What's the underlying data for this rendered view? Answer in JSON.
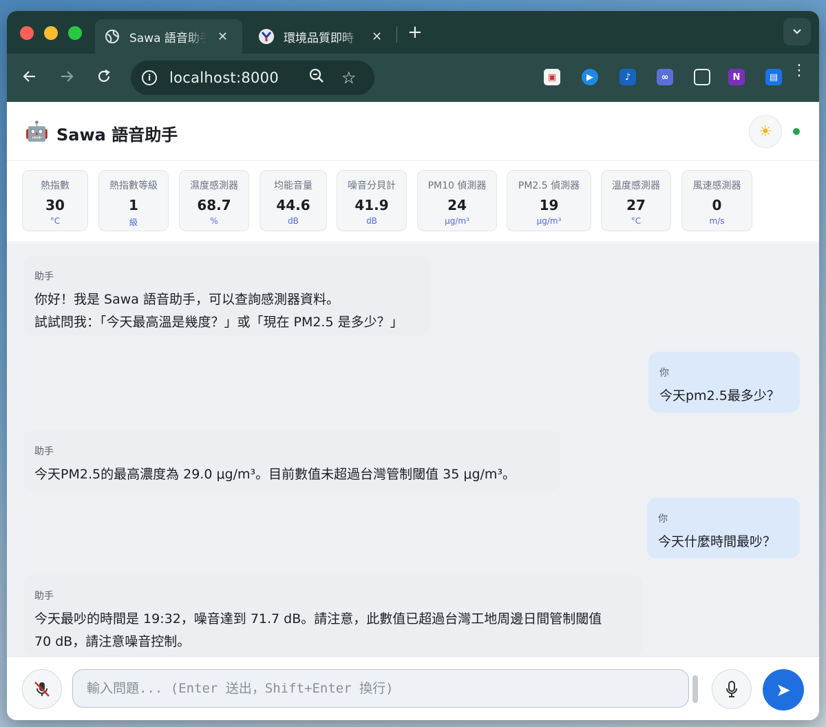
{
  "browser": {
    "tabs": [
      {
        "title": "Sawa 語音助手",
        "active": true,
        "favicon": "globe-icon"
      },
      {
        "title": "環境品質即時",
        "active": false,
        "favicon": "y-logo-icon"
      }
    ],
    "url": "localhost:8000"
  },
  "app": {
    "logo": "🤖",
    "title": "Sawa 語音助手",
    "theme_icon": "☀"
  },
  "sensors": [
    {
      "label": "熱指數",
      "value": "30",
      "unit": "°C"
    },
    {
      "label": "熱指數等級",
      "value": "1",
      "unit": "級"
    },
    {
      "label": "濕度感測器",
      "value": "68.7",
      "unit": "%"
    },
    {
      "label": "均能音量",
      "value": "44.6",
      "unit": "dB"
    },
    {
      "label": "噪音分貝計",
      "value": "41.9",
      "unit": "dB"
    },
    {
      "label": "PM10 偵測器",
      "value": "24",
      "unit": "μg/m³"
    },
    {
      "label": "PM2.5 偵測器",
      "value": "19",
      "unit": "μg/m³"
    },
    {
      "label": "溫度感測器",
      "value": "27",
      "unit": "°C"
    },
    {
      "label": "風速感測器",
      "value": "0",
      "unit": "m/s"
    }
  ],
  "messages": [
    {
      "role": "assistant",
      "who": "助手",
      "text": "你好！我是 Sawa 語音助手，可以查詢感測器資料。\n試試問我：「今天最高溫是幾度？」或「現在 PM2.5 是多少？」"
    },
    {
      "role": "user",
      "who": "你",
      "text": "今天pm2.5最多少？"
    },
    {
      "role": "assistant",
      "who": "助手",
      "text": "今天PM2.5的最高濃度為 29.0 μg/m³。目前數值未超過台灣管制閾值 35 μg/m³。"
    },
    {
      "role": "user",
      "who": "你",
      "text": "今天什麼時間最吵？"
    },
    {
      "role": "assistant",
      "who": "助手",
      "text": "今天最吵的時間是 19:32，噪音達到 71.7 dB。請注意，此數值已超過台灣工地周邊日間管制閾值\n70 dB，請注意噪音控制。"
    }
  ],
  "composer": {
    "placeholder": "輸入問題... (Enter 送出，Shift+Enter 換行)",
    "send_label": "➤"
  }
}
